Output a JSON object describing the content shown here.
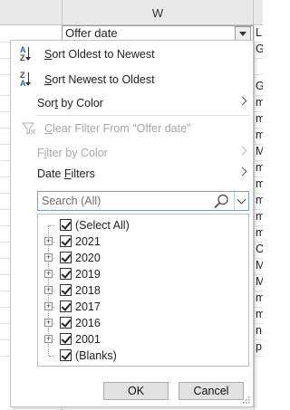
{
  "sheet": {
    "column_letter": "W",
    "header_cell_value": "Offer date",
    "right_column_cells": [
      "LE",
      "G",
      "",
      "G",
      "m",
      "m",
      "m",
      "M",
      "m",
      "m",
      "m",
      "m",
      "m",
      "C",
      "M",
      "M",
      "m",
      "m",
      "n",
      "p"
    ]
  },
  "menu": {
    "sort_asc": {
      "prefix": "S",
      "rest": "ort Oldest to Newest",
      "icon": "sort-ascending-icon"
    },
    "sort_desc": {
      "prefix": "S",
      "rest": "ort Newest to Oldest",
      "icon": "sort-descending-icon"
    },
    "sort_by_color": {
      "pre": "Sor",
      "key": "t",
      "post": " by Color"
    },
    "clear_filter": {
      "key": "C",
      "rest": "lear Filter From \"Offer date\"",
      "icon": "clear-filter-icon"
    },
    "filter_by_color": {
      "pre": "F",
      "key": "i",
      "post": "lter by Color"
    },
    "date_filters": {
      "pre": "Date ",
      "key": "F",
      "post": "ilters"
    }
  },
  "search": {
    "placeholder": "Search (All)",
    "value": ""
  },
  "tree_items": [
    {
      "label": "(Select All)",
      "checked": true
    },
    {
      "label": "2021",
      "checked": true,
      "expandable": true
    },
    {
      "label": "2020",
      "checked": true,
      "expandable": true
    },
    {
      "label": "2019",
      "checked": true,
      "expandable": true
    },
    {
      "label": "2018",
      "checked": true,
      "expandable": true
    },
    {
      "label": "2017",
      "checked": true,
      "expandable": true
    },
    {
      "label": "2016",
      "checked": true,
      "expandable": true
    },
    {
      "label": "2001",
      "checked": true,
      "expandable": true
    },
    {
      "label": "(Blanks)",
      "checked": true
    }
  ],
  "buttons": {
    "ok": "OK",
    "cancel": "Cancel"
  },
  "colors": {
    "accent": "#2e5ea8",
    "disabled_text": "#a6a6a6",
    "button_face": "#e1e1e1"
  }
}
